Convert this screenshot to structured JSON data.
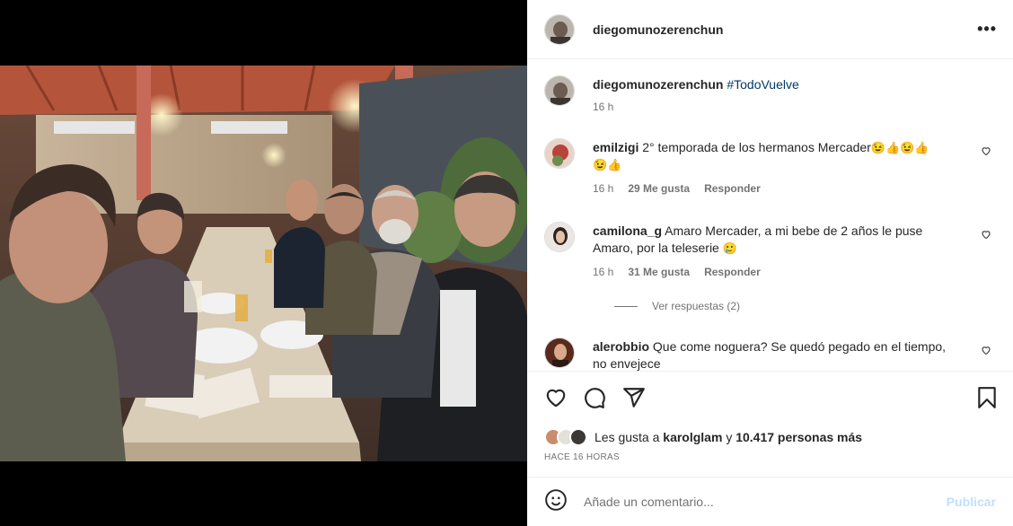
{
  "post": {
    "author": "diegomunozerenchun",
    "caption_hashtag": "#TodoVuelve",
    "caption_time": "16 h",
    "more_icon": "more-horizontal-icon"
  },
  "comments": [
    {
      "user": "emilzigi",
      "text": "2° temporada de los hermanos Mercader",
      "emojis_line1": "😉👍😉👍",
      "emojis_line2": "😉👍",
      "time": "16 h",
      "likes": "29 Me gusta",
      "reply": "Responder"
    },
    {
      "user": "camilona_g",
      "text": "Amaro Mercader, a mi bebe de 2 años le puse Amaro, por la teleserie",
      "emojis_line1": "🥲",
      "time": "16 h",
      "likes": "31 Me gusta",
      "reply": "Responder",
      "view_replies": "Ver respuestas (2)"
    },
    {
      "user": "alerobbio",
      "text": "Que come noguera? Se quedó pegado en el tiempo, no envejece"
    }
  ],
  "actions": {
    "like_icon": "heart-icon",
    "comment_icon": "comment-icon",
    "share_icon": "share-icon",
    "save_icon": "bookmark-icon"
  },
  "likes": {
    "prefix": "Les gusta a",
    "user": "karolglam",
    "connector": "y",
    "others": "10.417 personas más"
  },
  "posted_ago": "HACE 16 HORAS",
  "add_comment": {
    "placeholder": "Añade un comentario...",
    "publish": "Publicar",
    "emoji_icon": "emoji-icon"
  },
  "colors": {
    "link": "#00376b",
    "secondary": "#737373",
    "publish_disabled": "#c0dffd"
  }
}
